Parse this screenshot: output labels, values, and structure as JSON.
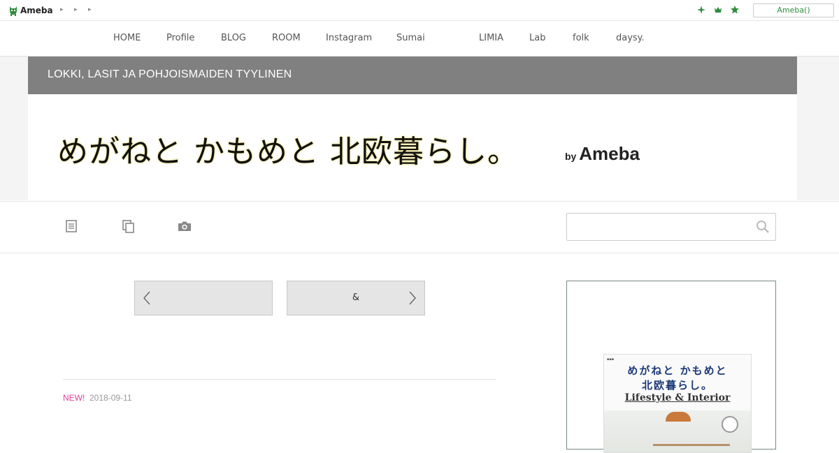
{
  "topbar": {
    "logo_text": "Ameba",
    "crumb_glyph": "▸",
    "user_button": "Ameba()",
    "icons": [
      "sparkle-icon",
      "crown-icon",
      "star-icon"
    ]
  },
  "nav": {
    "items": [
      "HOME",
      "Profile",
      "BLOG",
      "ROOM",
      "Instagram",
      "Sumai",
      "LIMIA",
      "Lab",
      "folk",
      "daysy."
    ]
  },
  "header": {
    "band_text": "LOKKI, LASIT JA POHJOISMAIDEN TYYLINEN",
    "blog_title": "めがねと かもめと 北欧暮らし。",
    "by": "by",
    "ameba": "Ameba"
  },
  "tools": {
    "icons": [
      "entry-list-icon",
      "copy-icon",
      "camera-icon"
    ],
    "search_placeholder": ""
  },
  "pager": {
    "prev_label": "",
    "next_label": "&"
  },
  "entry": {
    "new_badge": "NEW!",
    "date": "2018-09-11"
  },
  "sidebar": {
    "book": {
      "title_line1": "めがねと かもめと",
      "title_line2": "北欧暮らし。",
      "subtitle_left": "Lifestyle",
      "subtitle_amp": "&",
      "subtitle_right": "Interior"
    }
  },
  "colors": {
    "band": "#808080",
    "ameba_green": "#2d8c3c",
    "new_badge": "#e0409a",
    "book_title": "#1c3a78"
  }
}
